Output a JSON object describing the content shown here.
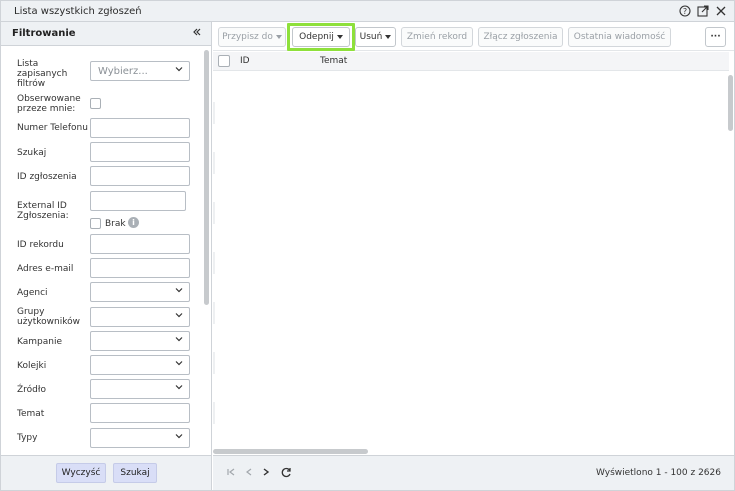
{
  "window": {
    "title": "Lista wszystkich zgłoszeń",
    "icons": [
      "help-icon",
      "export-icon",
      "close-icon"
    ]
  },
  "sidebar": {
    "header": "Filtrowanie",
    "filters": {
      "saved_filters": {
        "label": "Lista zapisanych filtrów",
        "placeholder": "Wybierz..."
      },
      "watched": {
        "label": "Obserwowane przeze mnie:"
      },
      "phone": {
        "label": "Numer Telefonu"
      },
      "search": {
        "label": "Szukaj"
      },
      "ticket_id": {
        "label": "ID zgłoszenia"
      },
      "external_id": {
        "label": "External ID Zgłoszenia:",
        "checkbox_label": "Brak"
      },
      "record_id": {
        "label": "ID rekordu"
      },
      "email": {
        "label": "Adres e-mail"
      },
      "agents": {
        "label": "Agenci"
      },
      "user_groups": {
        "label": "Grupy użytkowników"
      },
      "campaigns": {
        "label": "Kampanie"
      },
      "queues": {
        "label": "Kolejki"
      },
      "source": {
        "label": "Źródło"
      },
      "subject": {
        "label": "Temat"
      },
      "types": {
        "label": "Typy"
      }
    },
    "footer": {
      "clear": "Wyczyść",
      "search": "Szukaj"
    }
  },
  "toolbar": {
    "assign": "Przypisz do",
    "unpin": "Odepnij",
    "delete": "Usuń",
    "change_record": "Zmień rekord",
    "merge": "Złącz zgłoszenia",
    "last_message": "Ostatnia wiadomość",
    "more": "···"
  },
  "grid": {
    "columns": [
      "ID",
      "Temat"
    ]
  },
  "pager": {
    "info": "Wyświetlono 1 - 100 z 2626"
  },
  "colors": {
    "highlight": "#8ee03b",
    "soft_button": "#d9def7",
    "header_bg": "#eef1f4"
  }
}
